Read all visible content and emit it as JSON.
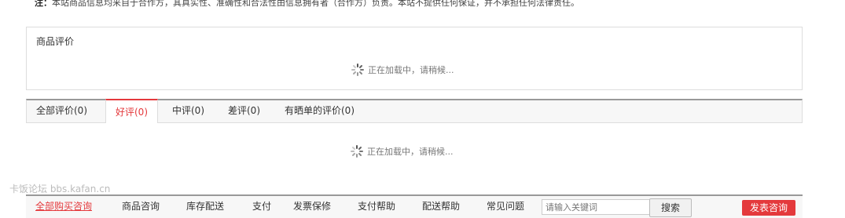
{
  "notice": {
    "label": "注：",
    "text": "本站商品信息均来自于合作方，其真实性、准确性和合法性由信息拥有者（合作方）负责。本站不提供任何保证，并不承担任何法律责任。"
  },
  "review_box": {
    "title": "商品评价",
    "loading_text": "正在加载中，请稍候..."
  },
  "review_tabs": [
    {
      "label": "全部评价(0)"
    },
    {
      "label": "好评(0)"
    },
    {
      "label": "中评(0)"
    },
    {
      "label": "差评(0)"
    },
    {
      "label": "有晒单的评价(0)"
    }
  ],
  "reviews_loading_text": "正在加载中，请稍候...",
  "watermark": "卡饭论坛 bbs.kafan.cn",
  "consult_tabs": [
    {
      "label": "全部购买咨询"
    },
    {
      "label": "商品咨询"
    },
    {
      "label": "库存配送"
    },
    {
      "label": "支付"
    },
    {
      "label": "发票保修"
    },
    {
      "label": "支付帮助"
    },
    {
      "label": "配送帮助"
    },
    {
      "label": "常见问题"
    }
  ],
  "consult_search": {
    "placeholder": "请输入关键词",
    "button_label": "搜索"
  },
  "post_button_label": "发表咨询",
  "colors": {
    "accent": "#e4393c",
    "border": "#dddddd",
    "tab_bar": "#f7f7f7"
  }
}
